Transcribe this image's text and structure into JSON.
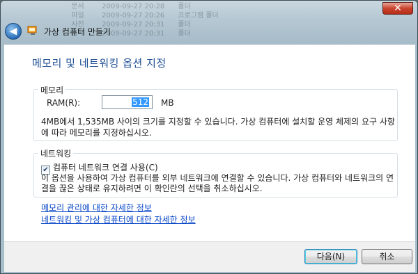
{
  "window": {
    "title": "가상 컴퓨터 만들기",
    "close_glyph": "✕",
    "back_glyph": "◀"
  },
  "background_text": "  문서        2009-09-27 20:28      폴더\n  파일        2009-09-27 20:26      프로그램 폴더\n  사진        2009-09-27 20:31      폴더\n  음악        2009-09-27 20:31      폴더",
  "heading": "메모리 및 네트워킹 옵션 지정",
  "memory": {
    "group_label": "메모리",
    "ram_label": "RAM(R):",
    "ram_value": "512",
    "unit": "MB",
    "description": "4MB에서 1,535MB 사이의 크기를 지정할 수 있습니다. 가상 컴퓨터에 설치할 운영 체제의 요구 사항에 따라 메모리를 지정하십시오."
  },
  "network": {
    "group_label": "네트워킹",
    "checkbox_label": "컴퓨터 네트워크 연결 사용(C)",
    "checked": true,
    "check_glyph": "✔",
    "description": "이 옵션을 사용하여 가상 컴퓨터를 외부 네트워크에 연결할 수 있습니다. 가상 컴퓨터와 네트워크의 연결을 끊은 상태로 유지하려면 이 확인란의 선택을 취소하십시오."
  },
  "links": {
    "memory_info": "메모리 관리에 대한 자세한 정보",
    "network_info": "네트워킹 및 가상 컴퓨터에 대한 자세한 정보"
  },
  "buttons": {
    "next": "다음(N)",
    "cancel": "취소"
  }
}
